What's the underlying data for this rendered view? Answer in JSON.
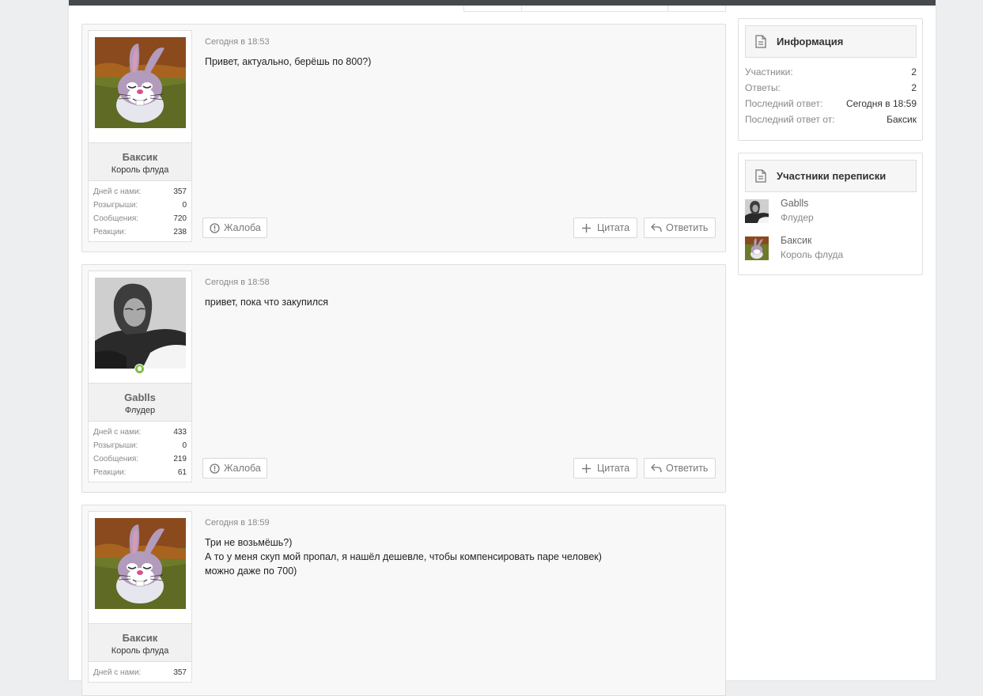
{
  "messages": [
    {
      "author": "Баксик",
      "title": "Король флуда",
      "avatar": "bunny-avatar",
      "online": false,
      "date": "Сегодня в 18:53",
      "lines": [
        "Привет, актуально, берёшь по 800?)"
      ],
      "stats": [
        {
          "label": "Дней с нами:",
          "value": "357"
        },
        {
          "label": "Розыгрыши:",
          "value": "0"
        },
        {
          "label": "Сообщения:",
          "value": "720"
        },
        {
          "label": "Реакции:",
          "value": "238"
        }
      ]
    },
    {
      "author": "Gablls",
      "title": "Флудер",
      "avatar": "photo-avatar",
      "online": true,
      "date": "Сегодня в 18:58",
      "lines": [
        "привет, пока что закупился"
      ],
      "stats": [
        {
          "label": "Дней с нами:",
          "value": "433"
        },
        {
          "label": "Розыгрыши:",
          "value": "0"
        },
        {
          "label": "Сообщения:",
          "value": "219"
        },
        {
          "label": "Реакции:",
          "value": "61"
        }
      ]
    },
    {
      "author": "Баксик",
      "title": "Король флуда",
      "avatar": "bunny-avatar",
      "online": false,
      "date": "Сегодня в 18:59",
      "lines": [
        "Три не возьмёшь?)",
        "А то у меня скуп мой пропал, я нашёл дешевле, чтобы компенсировать паре человек)",
        "можно даже по 700)"
      ],
      "stats": [
        {
          "label": "Дней с нами:",
          "value": "357"
        }
      ]
    }
  ],
  "actions": {
    "report_label": "Жалоба",
    "quote_label": "Цитата",
    "reply_label": "Ответить"
  },
  "info": {
    "title": "Информация",
    "rows": [
      {
        "label": "Участники:",
        "value": "2"
      },
      {
        "label": "Ответы:",
        "value": "2"
      },
      {
        "label": "Последний ответ:",
        "value": "Сегодня в 18:59"
      },
      {
        "label": "Последний ответ от:",
        "value": "Баксик"
      }
    ]
  },
  "participants": {
    "title": "Участники переписки",
    "items": [
      {
        "name": "Gablls",
        "title": "Флудер",
        "avatar": "photo-avatar"
      },
      {
        "name": "Баксик",
        "title": "Король флуда",
        "avatar": "bunny-avatar"
      }
    ]
  },
  "colors": {
    "page_bg": "#eceef0",
    "topbar": "#45494e",
    "online": "#7fbf3f"
  }
}
